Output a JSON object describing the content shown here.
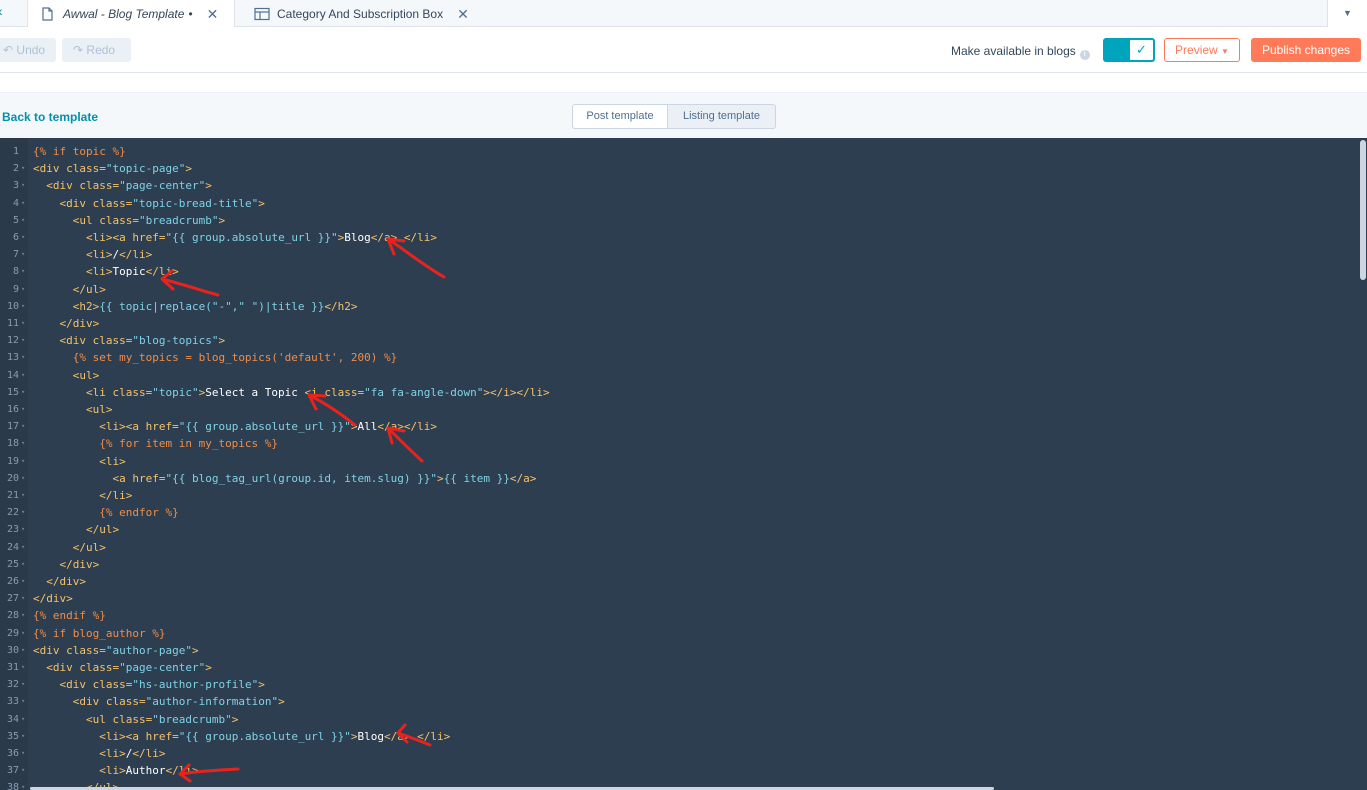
{
  "tabs": [
    {
      "label": "Awwal - Blog Template",
      "suffix": "•",
      "active": true,
      "icon": "document-icon"
    },
    {
      "label": "Category And Subscription Box",
      "active": false,
      "icon": "layout-icon"
    }
  ],
  "toolbar": {
    "undo_label": "Undo",
    "redo_label": "Redo",
    "availability_label": "Make available in blogs",
    "preview_label": "Preview",
    "publish_label": "Publish changes"
  },
  "subheader": {
    "back_label": "Back to template",
    "segments": [
      "Post template",
      "Listing template"
    ]
  },
  "colors": {
    "accent": "#ff7a59",
    "toggle": "#00a4bd",
    "editor_bg": "#2d3e50"
  },
  "code_lines": [
    "{% if topic %}",
    "<div class=\"topic-page\">",
    "  <div class=\"page-center\">",
    "    <div class=\"topic-bread-title\">",
    "      <ul class=\"breadcrumb\">",
    "        <li><a href=\"{{ group.absolute_url }}\">Blog</a> </li>",
    "        <li>/</li>",
    "        <li>Topic</li>",
    "      </ul>",
    "      <h2>{{ topic|replace(\"-\",\" \")|title }}</h2>",
    "    </div>",
    "    <div class=\"blog-topics\">",
    "      {% set my_topics = blog_topics('default', 200) %}",
    "      <ul>",
    "        <li class=\"topic\">Select a Topic <i class=\"fa fa-angle-down\"></i></li>",
    "        <ul>",
    "          <li><a href=\"{{ group.absolute_url }}\">All</a></li>",
    "          {% for item in my_topics %}",
    "          <li>",
    "            <a href=\"{{ blog_tag_url(group.id, item.slug) }}\">{{ item }}</a>",
    "          </li>",
    "          {% endfor %}",
    "        </ul>",
    "      </ul>",
    "    </div>",
    "  </div>",
    "</div>",
    "{% endif %}",
    "{% if blog_author %}",
    "<div class=\"author-page\">",
    "  <div class=\"page-center\">",
    "    <div class=\"hs-author-profile\">",
    "      <div class=\"author-information\">",
    "        <ul class=\"breadcrumb\">",
    "          <li><a href=\"{{ group.absolute_url }}\">Blog</a> </li>",
    "          <li>/</li>",
    "          <li>Author</li>",
    "        </ul>"
  ]
}
